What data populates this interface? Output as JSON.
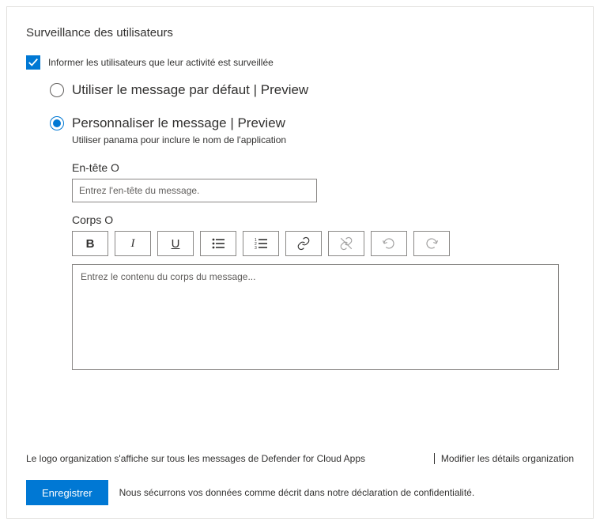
{
  "title": "Surveillance des utilisateurs",
  "notify": {
    "checkbox_label": "Informer les utilisateurs que leur activité est surveillée",
    "option_default": "Utiliser le message par défaut | Preview",
    "option_custom": "Personnaliser le message | Preview",
    "custom_hint": "Utiliser panama pour inclure le nom de l'application"
  },
  "header_field": {
    "label": "En-tête O",
    "placeholder": "Entrez l'en-tête du message."
  },
  "body_field": {
    "label": "Corps O",
    "placeholder": "Entrez le contenu du corps du message..."
  },
  "toolbar": {
    "bold": "B",
    "italic": "I",
    "underline": "U"
  },
  "footer": {
    "logo_note": "Le logo organization s'affiche sur tous les messages de Defender for Cloud Apps",
    "edit_org": "Modifier les détails organization"
  },
  "save": {
    "button": "Enregistrer",
    "privacy": "Nous sécurrons vos données comme décrit dans notre déclaration de confidentialité."
  }
}
